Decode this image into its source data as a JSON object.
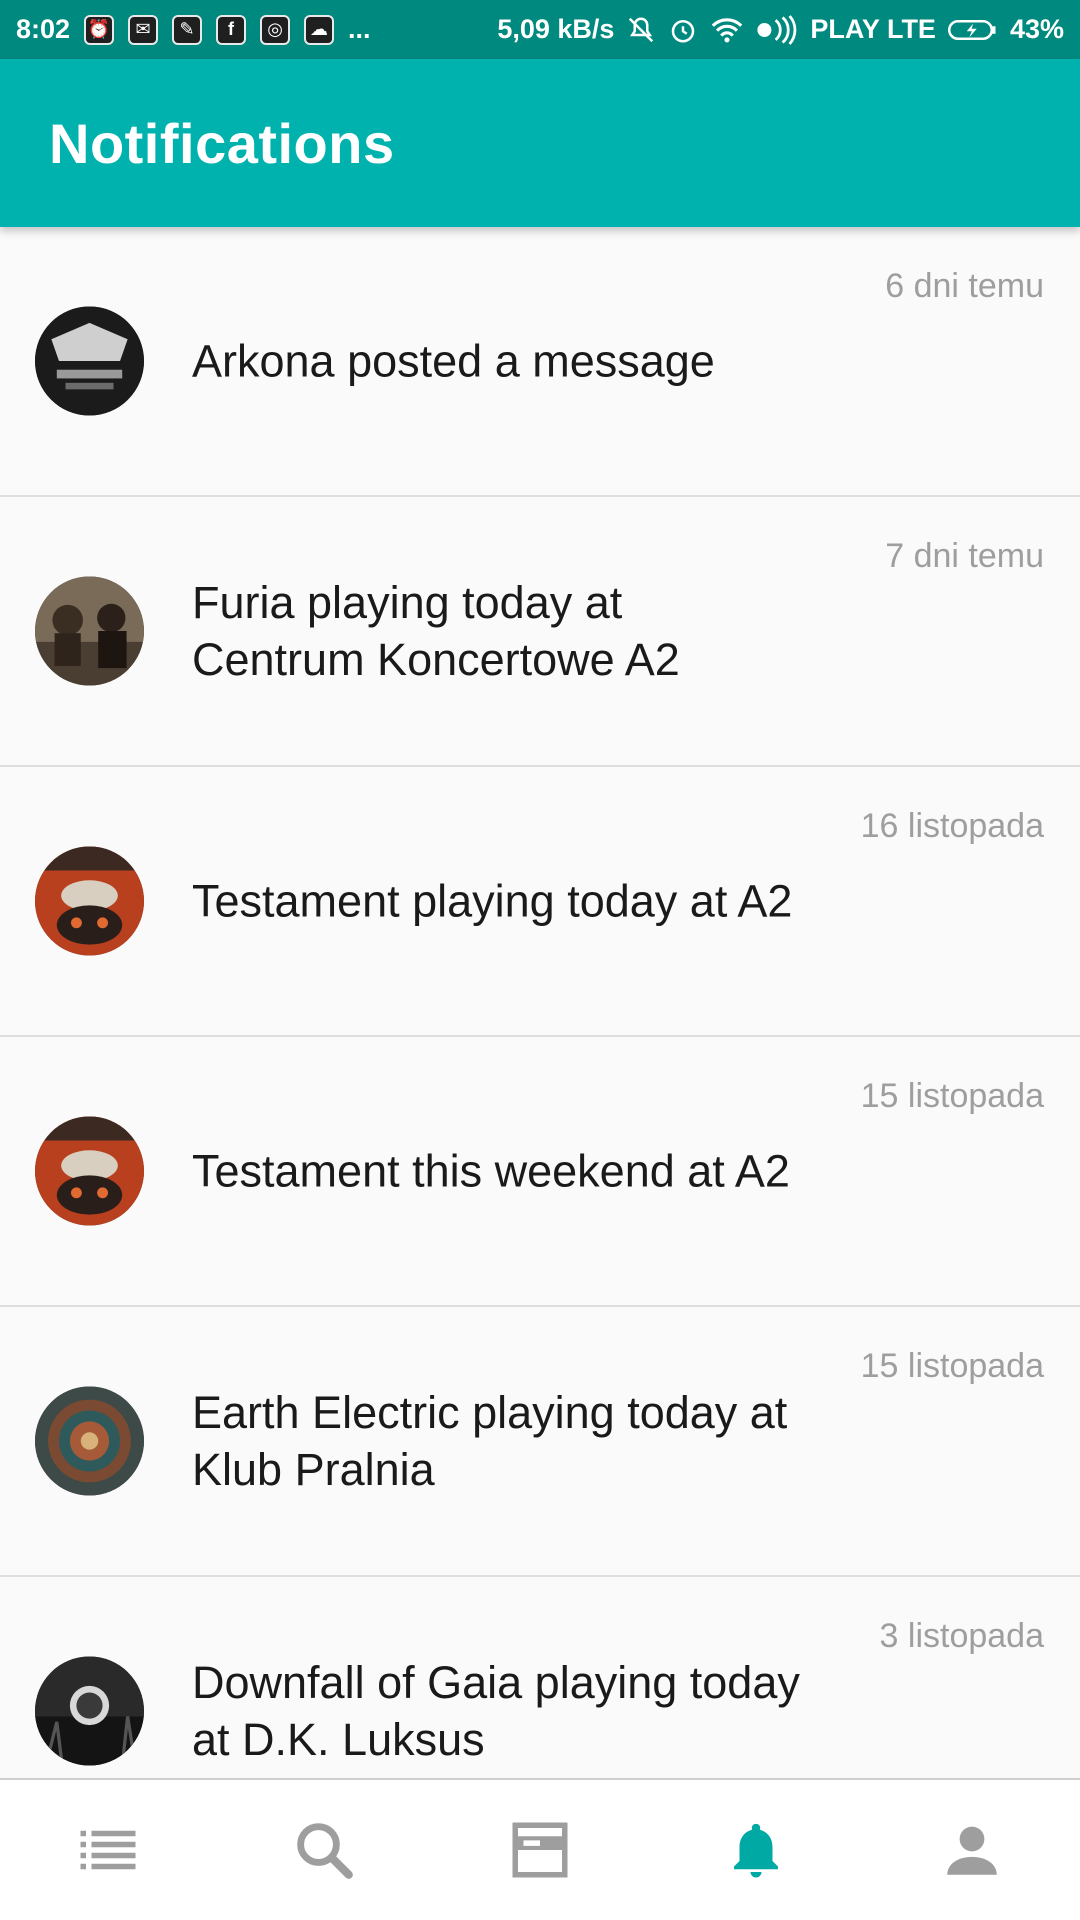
{
  "status_bar": {
    "time": "8:02",
    "speed": "5,09 kB/s",
    "carrier": "PLAY LTE",
    "battery": "43%",
    "more": "..."
  },
  "app_bar": {
    "title": "Notifications"
  },
  "notifications": [
    {
      "text": "Arkona posted a message",
      "time": "6 dni temu",
      "avatar_icon": "arkona-avatar"
    },
    {
      "text": "Furia playing today at Centrum Koncertowe A2",
      "time": "7 dni temu",
      "avatar_icon": "furia-avatar"
    },
    {
      "text": "Testament playing today at A2",
      "time": "16 listopada",
      "avatar_icon": "testament-avatar"
    },
    {
      "text": "Testament this weekend at A2",
      "time": "15 listopada",
      "avatar_icon": "testament-avatar"
    },
    {
      "text": "Earth Electric playing today at Klub Pralnia",
      "time": "15 listopada",
      "avatar_icon": "earth-electric-avatar"
    },
    {
      "text": "Downfall of Gaia playing today at D.K. Luksus",
      "time": "3 listopada",
      "avatar_icon": "downfall-of-gaia-avatar"
    }
  ],
  "bottom_nav": [
    {
      "icon": "list-icon",
      "active": false
    },
    {
      "icon": "search-icon",
      "active": false
    },
    {
      "icon": "calendar-card-icon",
      "active": false
    },
    {
      "icon": "bell-icon",
      "active": true
    },
    {
      "icon": "person-icon",
      "active": false
    }
  ],
  "colors": {
    "status_bar": "#00897f",
    "app_bar": "#00b2ae",
    "active_nav": "#00a9a3",
    "inactive_nav": "#9e9e9e"
  }
}
